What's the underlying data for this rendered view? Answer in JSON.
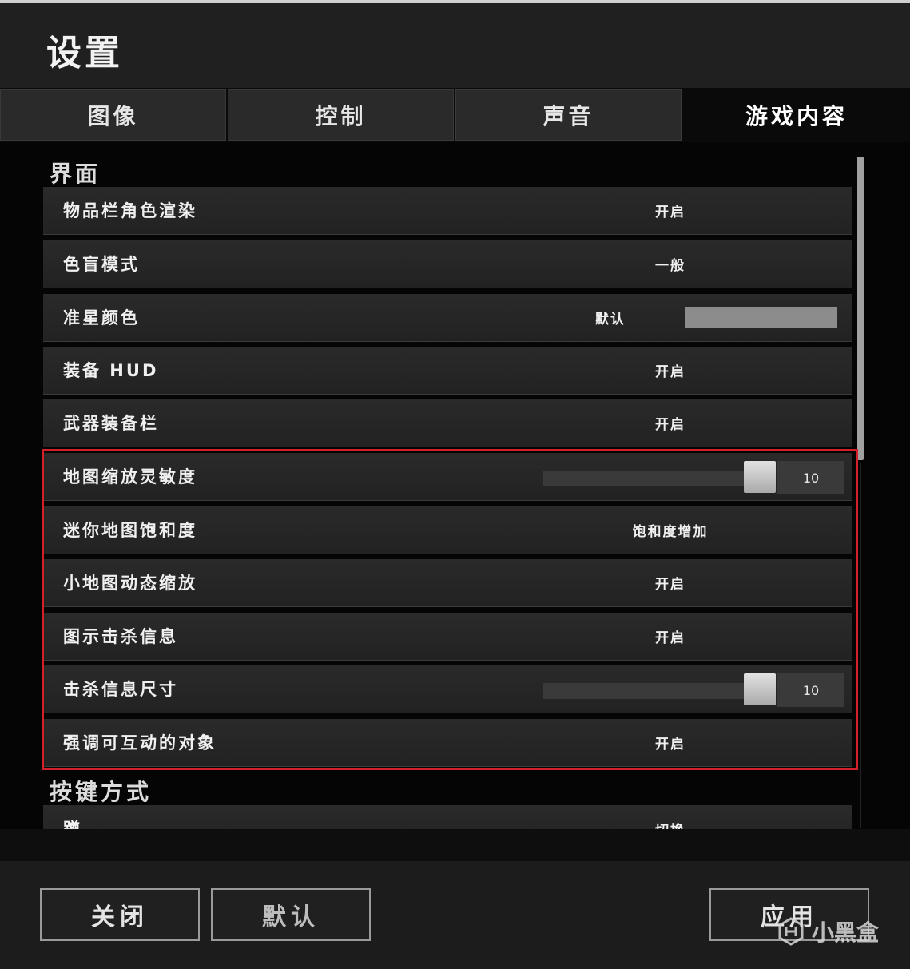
{
  "title": "设置",
  "tabs": [
    {
      "label": "图像"
    },
    {
      "label": "控制"
    },
    {
      "label": "声音"
    },
    {
      "label": "游戏内容",
      "active": true
    }
  ],
  "sections": [
    {
      "title": "界面",
      "rows": [
        {
          "label": "物品栏角色渲染",
          "value": "开启"
        },
        {
          "label": "色盲模式",
          "value": "一般"
        },
        {
          "label": "准星颜色",
          "value": "默认",
          "swatch_color": "#8c8c8c"
        },
        {
          "label": "装备 HUD",
          "value": "开启"
        },
        {
          "label": "武器装备栏",
          "value": "开启"
        },
        {
          "label": "地图缩放灵敏度",
          "slider_value": "10",
          "slider_fraction": 1.0
        },
        {
          "label": "迷你地图饱和度",
          "value": "饱和度增加"
        },
        {
          "label": "小地图动态缩放",
          "value": "开启"
        },
        {
          "label": "图示击杀信息",
          "value": "开启"
        },
        {
          "label": "击杀信息尺寸",
          "slider_value": "10",
          "slider_fraction": 1.0
        },
        {
          "label": "强调可互动的对象",
          "value": "开启"
        }
      ]
    },
    {
      "title": "按键方式",
      "rows": [
        {
          "label": "蹲",
          "value": "切换"
        }
      ]
    }
  ],
  "footer": {
    "close_label": "关闭",
    "default_label": "默认",
    "apply_label": "应用"
  },
  "watermark": {
    "text": "小黑盒"
  },
  "colors": {
    "highlight": "#d3202a",
    "background": "#050505",
    "row": "#262626"
  }
}
